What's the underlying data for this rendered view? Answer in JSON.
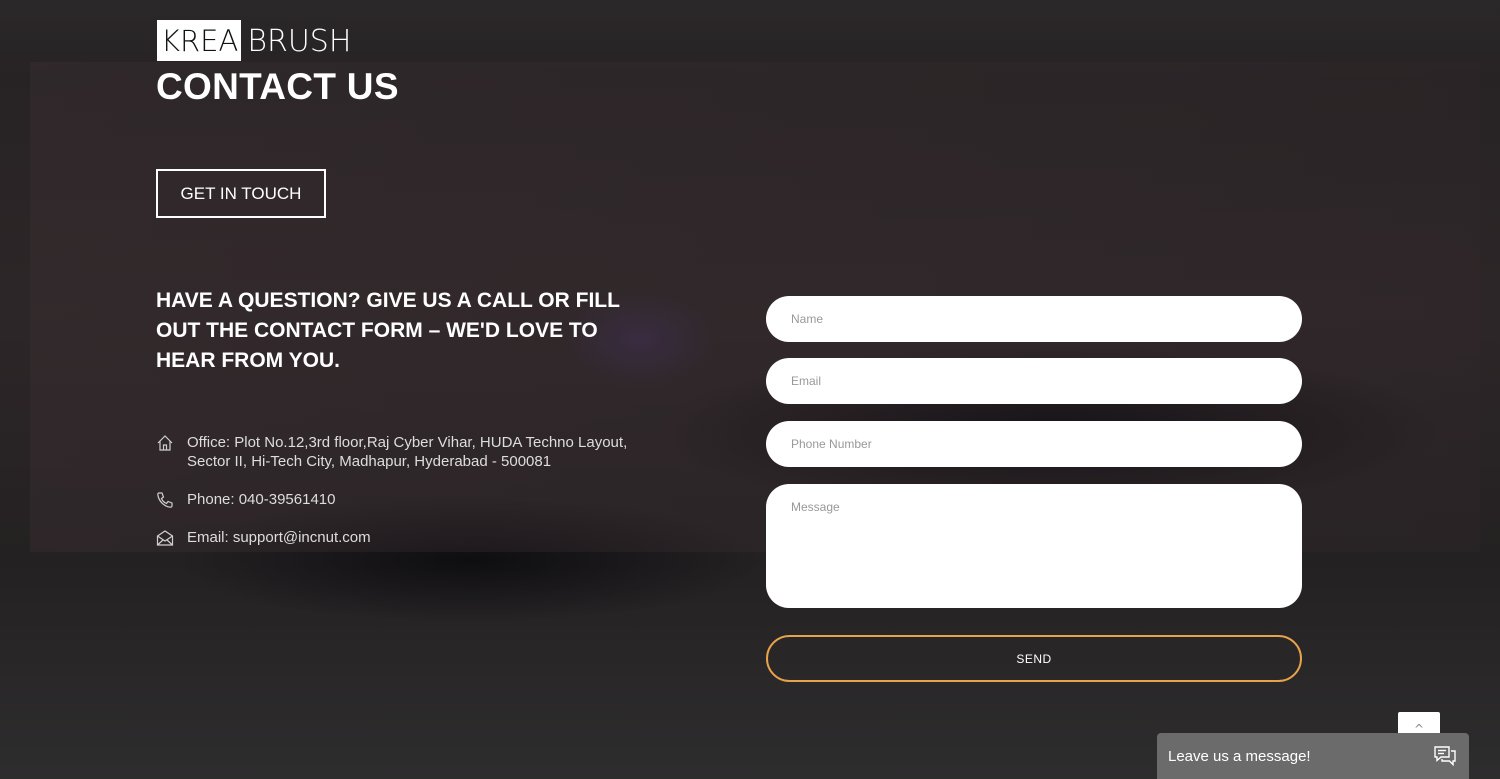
{
  "brand": {
    "logo_part1": "KREA",
    "logo_part2": "BRUSH"
  },
  "page_title": "CONTACT US",
  "get_in_touch_label": "GET IN TOUCH",
  "headline": "HAVE A QUESTION? GIVE US A CALL OR FILL OUT THE CONTACT FORM – WE'D LOVE TO HEAR FROM YOU.",
  "contact": {
    "office": "Office: Plot No.12,3rd floor,Raj Cyber Vihar, HUDA Techno Layout, Sector II, Hi-Tech City, Madhapur, Hyderabad - 500081",
    "phone": "Phone: 040-39561410",
    "email": "Email: support@incnut.com"
  },
  "form": {
    "name_placeholder": "Name",
    "email_placeholder": "Email",
    "phone_placeholder": "Phone Number",
    "message_placeholder": "Message",
    "send_label": "SEND"
  },
  "chat_widget": {
    "label": "Leave us a message!",
    "icon": "chat-bubbles-icon"
  },
  "scroll_top": {
    "icon": "chevron-up-icon",
    "glyph": "^"
  },
  "colors": {
    "accent": "#e8a24c",
    "text": "#ffffff",
    "chat_bg": "#6b6b6b"
  }
}
